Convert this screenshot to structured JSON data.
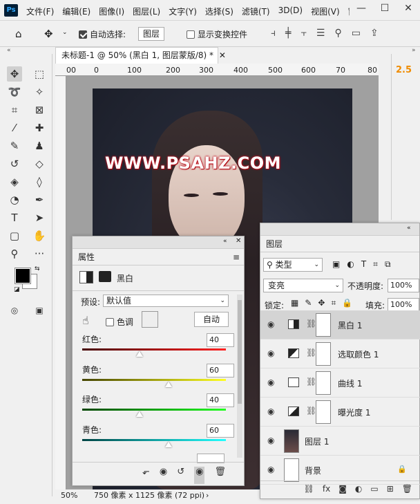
{
  "app": {
    "logo": "Ps"
  },
  "menu": [
    "文件(F)",
    "编辑(E)",
    "图像(I)",
    "图层(L)",
    "文字(Y)",
    "选择(S)",
    "滤镜(T)",
    "3D(D)",
    "视图(V)",
    "窗"
  ],
  "window_controls": {
    "minimize": "—",
    "maximize": "☐",
    "close": "✕"
  },
  "options_bar": {
    "auto_select_label": "自动选择:",
    "auto_select_checked": true,
    "auto_select_value": "图层",
    "transform_controls_label": "显示变换控件",
    "transform_controls_checked": false
  },
  "document": {
    "tab_title": "未标题-1 @ 50% (黑白 1, 图层蒙版/8) *",
    "ruler_ticks": [
      "00",
      "0",
      "100",
      "200",
      "300",
      "400",
      "500",
      "600",
      "70",
      "80"
    ],
    "watermark": "WWW.PSAHZ.COM",
    "zoom": "50%",
    "doc_info": "750 像素 x 1125 像素 (72 ppi)"
  },
  "right_strip": {
    "value": "2.5"
  },
  "properties": {
    "title": "属性",
    "adjustment_name": "黑白",
    "preset_label": "预设:",
    "preset_value": "默认值",
    "tint_label": "色调",
    "tint_checked": false,
    "auto_button": "自动",
    "sliders": [
      {
        "label": "红色:",
        "value": "40",
        "level": 0.4
      },
      {
        "label": "黄色:",
        "value": "60",
        "level": 0.6
      },
      {
        "label": "绿色:",
        "value": "40",
        "level": 0.4
      },
      {
        "label": "青色:",
        "value": "60",
        "level": 0.6
      }
    ]
  },
  "layers": {
    "title": "图层",
    "filter_kind": "类型",
    "blend_mode": "变亮",
    "opacity_label": "不透明度:",
    "opacity_value": "100%",
    "lock_label": "锁定:",
    "fill_label": "填充:",
    "fill_value": "100%",
    "items": [
      {
        "name": "黑白",
        "num": "1",
        "selected": true
      },
      {
        "name": "选取颜色",
        "num": "1",
        "selected": false
      },
      {
        "name": "曲线",
        "num": "1",
        "selected": false
      },
      {
        "name": "曝光度",
        "num": "1",
        "selected": false
      },
      {
        "name": "图层",
        "num": "1",
        "selected": false
      },
      {
        "name": "背景",
        "num": "",
        "selected": false
      }
    ]
  }
}
